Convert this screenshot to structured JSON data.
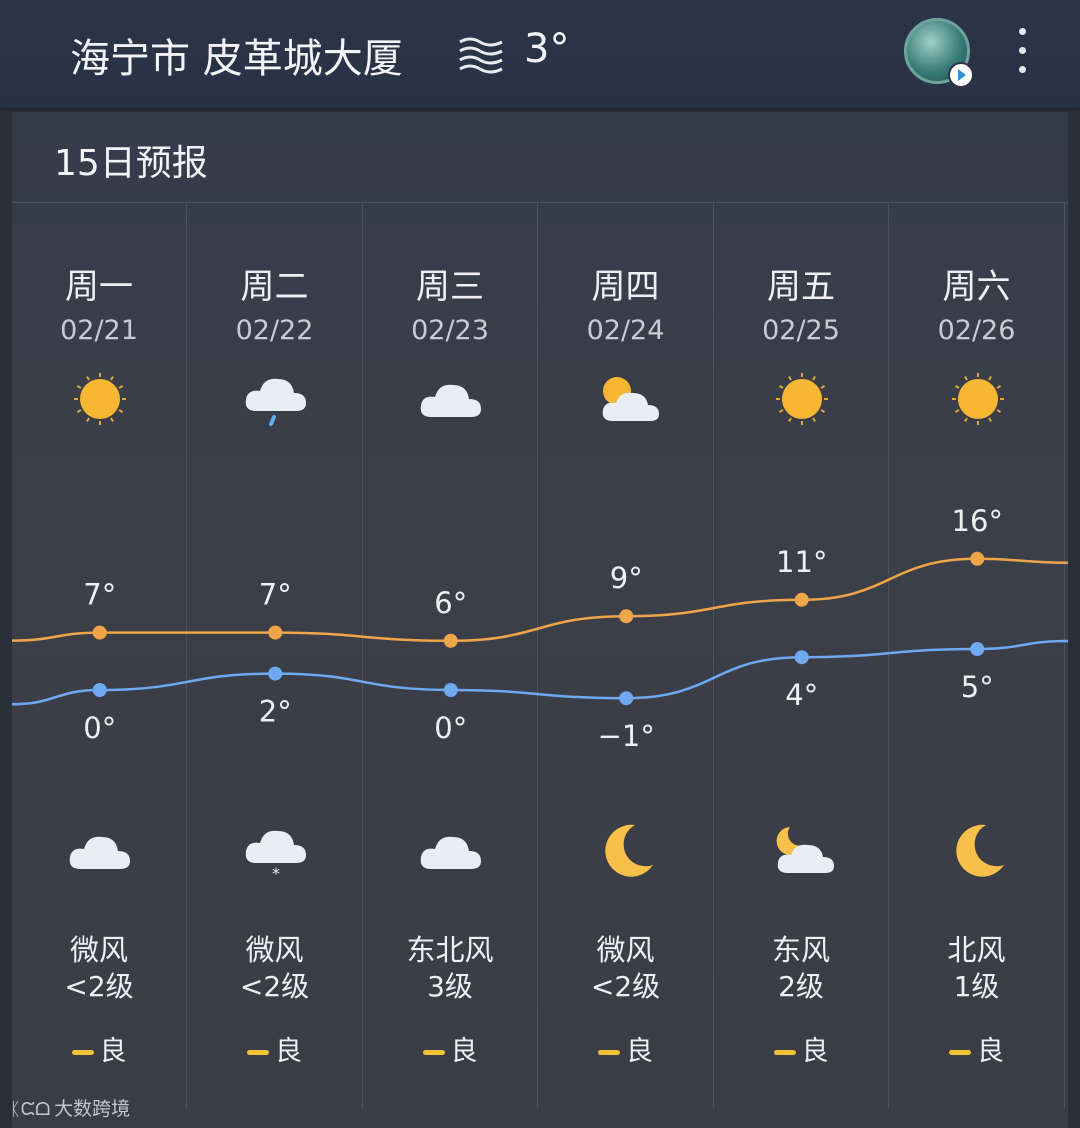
{
  "header": {
    "location": "海宁市 皮革城大厦",
    "current_temp": "3°",
    "wind_icon": "wind-waves-icon",
    "avatar_icon": "avatar-icon",
    "menu_icon": "more-vertical-icon"
  },
  "panel": {
    "title": "15日预报"
  },
  "days": [
    {
      "day": "周一",
      "date": "02/21",
      "day_icon": "sun-icon",
      "night_icon": "cloud-icon",
      "wind_dir": "微风",
      "wind_level": "<2级",
      "aqi": "良"
    },
    {
      "day": "周二",
      "date": "02/22",
      "day_icon": "rain-cloud-icon",
      "night_icon": "snow-cloud-icon",
      "wind_dir": "微风",
      "wind_level": "<2级",
      "aqi": "良"
    },
    {
      "day": "周三",
      "date": "02/23",
      "day_icon": "cloud-icon",
      "night_icon": "cloud-icon",
      "wind_dir": "东北风",
      "wind_level": "3级",
      "aqi": "良"
    },
    {
      "day": "周四",
      "date": "02/24",
      "day_icon": "partly-sunny-icon",
      "night_icon": "moon-icon",
      "wind_dir": "微风",
      "wind_level": "<2级",
      "aqi": "良"
    },
    {
      "day": "周五",
      "date": "02/25",
      "day_icon": "sun-icon",
      "night_icon": "moon-cloud-icon",
      "wind_dir": "东风",
      "wind_level": "2级",
      "aqi": "良"
    },
    {
      "day": "周六",
      "date": "02/26",
      "day_icon": "sun-icon",
      "night_icon": "moon-icon",
      "wind_dir": "北风",
      "wind_level": "1级",
      "aqi": "良"
    }
  ],
  "chart_data": {
    "type": "line",
    "categories": [
      "02/21",
      "02/22",
      "02/23",
      "02/24",
      "02/25",
      "02/26"
    ],
    "series": [
      {
        "values": [
          7,
          7,
          6,
          9,
          11,
          16
        ],
        "labels": [
          "7°",
          "7°",
          "6°",
          "9°",
          "11°",
          "16°"
        ],
        "color": "#f0a54a"
      },
      {
        "values": [
          0,
          2,
          0,
          -1,
          4,
          5
        ],
        "labels": [
          "0°",
          "2°",
          "0°",
          "−1°",
          "4°",
          "5°"
        ],
        "color": "#6ea9f2"
      }
    ]
  },
  "colors": {
    "high": "#f0a54a",
    "low": "#6ea9f2",
    "aqi_good": "#f2c238"
  },
  "watermark": {
    "logo_text": "ᛕᙅᗝ",
    "text": "大数跨境"
  }
}
